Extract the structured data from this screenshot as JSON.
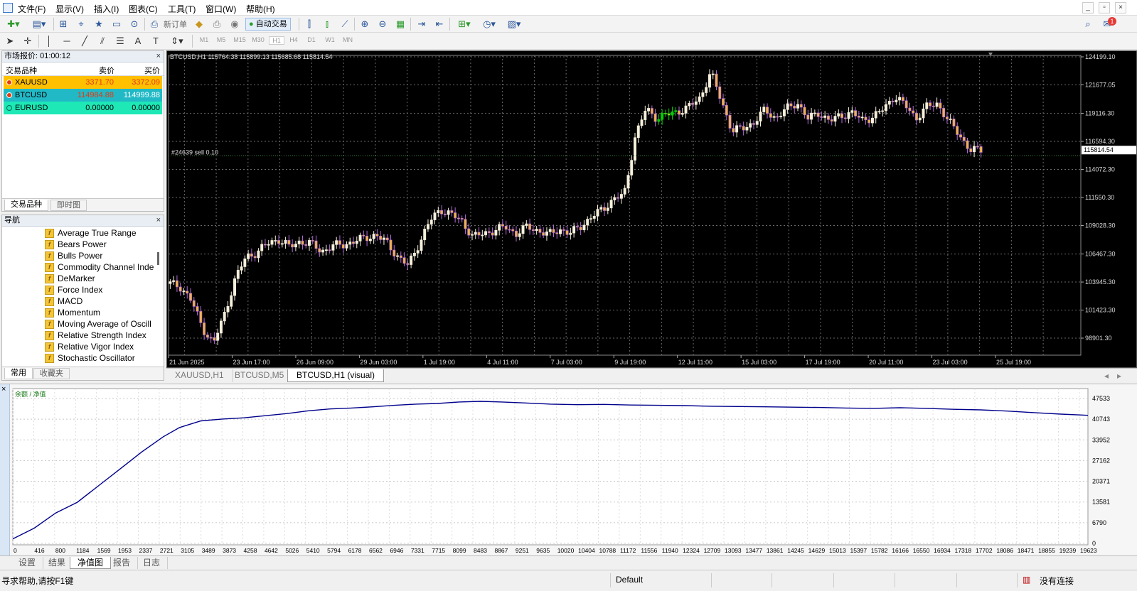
{
  "menu": [
    "文件(F)",
    "显示(V)",
    "插入(I)",
    "图表(C)",
    "工具(T)",
    "窗口(W)",
    "帮助(H)"
  ],
  "toolbar": {
    "new_order_label": "新订单",
    "auto_trade_label": "自动交易",
    "timeframes": [
      "M1",
      "M5",
      "M15",
      "M30",
      "H1",
      "H4",
      "D1",
      "W1",
      "MN"
    ],
    "active_timeframe": "H1",
    "notification_count": "1"
  },
  "market_watch": {
    "title": "市场报价: 01:00:12",
    "col_symbol": "交易品种",
    "col_bid": "卖价",
    "col_ask": "买价",
    "rows": [
      {
        "symbol": "XAUUSD",
        "bid": "3371.70",
        "ask": "3372.09",
        "bg": "#ffc000",
        "bid_color": "#e8380d",
        "ask_color": "#e8380d"
      },
      {
        "symbol": "BTCUSD",
        "bid": "114984.88",
        "ask": "114999.88",
        "bg": "#21b9c6",
        "bid_color": "#e8380d",
        "ask_color": "#ffffff"
      },
      {
        "symbol": "EURUSD",
        "bid": "0.00000",
        "ask": "0.00000",
        "bg": "#1de8b6",
        "bid_color": "#000000",
        "ask_color": "#000000"
      }
    ],
    "tabs": [
      "交易品种",
      "即时图"
    ]
  },
  "navigator": {
    "title": "导航",
    "items": [
      "Average True Range",
      "Bears Power",
      "Bulls Power",
      "Commodity Channel Inde",
      "DeMarker",
      "Force Index",
      "MACD",
      "Momentum",
      "Moving Average of Oscill",
      "Relative Strength Index",
      "Relative Vigor Index",
      "Stochastic Oscillator"
    ],
    "tabs": [
      "常用",
      "收藏夹"
    ]
  },
  "chart": {
    "info": "BTCUSD,H1  115764.38 115899.13 115685.68 115814.54",
    "order_label": "#24639 sell 0.10",
    "current_price": "115814.54",
    "tabs": [
      "XAUUSD,H1",
      "BTCUSD,M5",
      "BTCUSD,H1 (visual)"
    ],
    "active_tab": 2
  },
  "chart_data": [
    {
      "type": "line",
      "title": "BTCUSD,H1",
      "x_tick_labels": [
        "21 Jun 2025",
        "23 Jun 17:00",
        "26 Jun 09:00",
        "29 Jun 03:00",
        "1 Jul 19:00",
        "4 Jul 11:00",
        "7 Jul 03:00",
        "9 Jul 19:00",
        "12 Jul 11:00",
        "15 Jul 03:00",
        "17 Jul 19:00",
        "20 Jul 11:00",
        "23 Jul 03:00",
        "25 Jul 19:00"
      ],
      "y_tick_labels": [
        "124199.10",
        "121677.05",
        "119116.30",
        "116594.30",
        "114072.30",
        "111550.30",
        "109028.30",
        "106467.30",
        "103945.30",
        "101423.30",
        "98901.30"
      ],
      "ylim": [
        98901.3,
        124199.1
      ],
      "grid": true,
      "series": [
        {
          "values": [
            103800,
            103500,
            102200,
            99800,
            98400,
            101000,
            104200,
            106200,
            106600,
            107400,
            107800,
            107100,
            107600,
            107400,
            106700,
            107200,
            107300,
            107600,
            107900,
            108200,
            107500,
            106300,
            105400,
            107400,
            109400,
            110500,
            110000,
            109400,
            108000,
            108300,
            108600,
            108900,
            108300,
            108900,
            108600,
            108200,
            108700,
            108300,
            109000,
            109800,
            110500,
            111400,
            111800,
            117000,
            119500,
            118700,
            119000,
            119300,
            119700,
            120500,
            122800,
            120200,
            117500,
            117800,
            118300,
            119400,
            118700,
            119500,
            120100,
            118600,
            119200,
            118400,
            118900,
            119200,
            118500,
            118800,
            119500,
            120700,
            119800,
            118700,
            119700,
            120000,
            118400,
            117200,
            115800,
            115814
          ]
        }
      ]
    },
    {
      "type": "line",
      "title": "余额 / 净值",
      "x_tick_labels": [
        "0",
        "416",
        "800",
        "1184",
        "1569",
        "1953",
        "2337",
        "2721",
        "3105",
        "3489",
        "3873",
        "4258",
        "4642",
        "5026",
        "5410",
        "5794",
        "6178",
        "6562",
        "6946",
        "7331",
        "7715",
        "8099",
        "8483",
        "8867",
        "9251",
        "9635",
        "10020",
        "10404",
        "10788",
        "11172",
        "11556",
        "11940",
        "12324",
        "12709",
        "13093",
        "13477",
        "13861",
        "14245",
        "14629",
        "15013",
        "15397",
        "15782",
        "16166",
        "16550",
        "16934",
        "17318",
        "17702",
        "18086",
        "18471",
        "18855",
        "19239",
        "19623"
      ],
      "y_tick_labels": [
        "47533",
        "40743",
        "33952",
        "27162",
        "20371",
        "13581",
        "6790",
        "0"
      ],
      "xlim": [
        0,
        20000
      ],
      "ylim": [
        0,
        47533
      ],
      "grid": true,
      "series": [
        {
          "name": "余额",
          "color": "#00008b",
          "x": [
            0,
            400,
            800,
            1200,
            1600,
            2000,
            2400,
            2800,
            3100,
            3500,
            3900,
            4300,
            4700,
            5100,
            5500,
            5900,
            6300,
            6700,
            7100,
            7500,
            7900,
            8300,
            8700,
            9100,
            9500,
            10000,
            10500,
            11000,
            11500,
            12000,
            12500,
            13000,
            13500,
            14000,
            14500,
            15000,
            15500,
            16000,
            16500,
            17000,
            17500,
            18000,
            18500,
            19000,
            19500,
            20000
          ],
          "values": [
            1500,
            5000,
            10000,
            13500,
            19000,
            24500,
            30000,
            35000,
            38000,
            40200,
            40800,
            41200,
            41900,
            42600,
            43500,
            44100,
            44400,
            44800,
            45300,
            45700,
            45900,
            46400,
            46600,
            46400,
            46100,
            45700,
            45500,
            45600,
            45400,
            45300,
            45200,
            45000,
            44900,
            44800,
            44700,
            44600,
            44400,
            44300,
            44500,
            44300,
            44000,
            43800,
            43400,
            42900,
            42400,
            42000
          ]
        }
      ]
    }
  ],
  "tester": {
    "tabs": [
      "设置",
      "结果",
      "净值图",
      "报告",
      "日志"
    ],
    "active_tab": 2
  },
  "status": {
    "help": "寻求帮助,请按F1键",
    "profile": "Default",
    "connection": "没有连接"
  },
  "colors": {
    "candle_up": "#f6f0dc",
    "candle_down": "#b26bd8",
    "balance_line": "#00008b"
  }
}
